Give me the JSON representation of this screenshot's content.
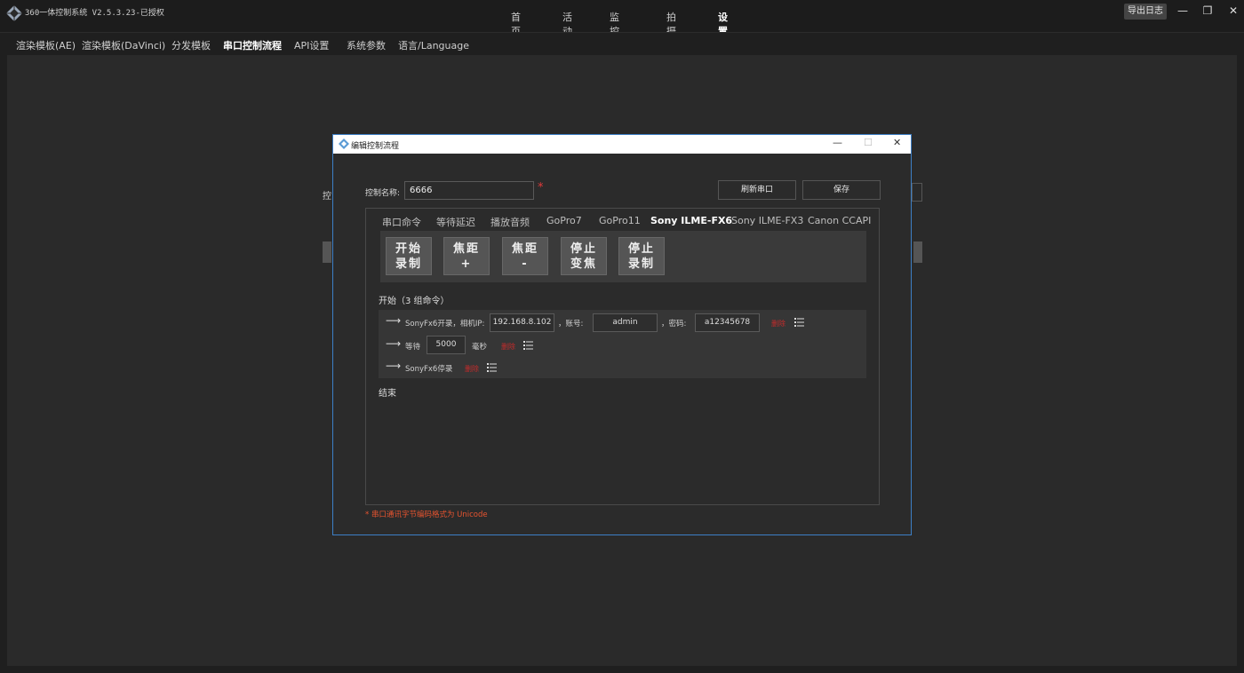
{
  "app": {
    "title": "360一体控制系统 V2.5.3.23-已授权",
    "export_log": "导出日志",
    "nav": [
      "首页",
      "活动",
      "监控台",
      "拍摄",
      "设置"
    ],
    "active_nav": "设置"
  },
  "subnav": [
    "渲染模板(AE)",
    "渲染模板(DaVinci)",
    "分发模板",
    "串口控制流程",
    "API设置",
    "系统参数",
    "语言/Language"
  ],
  "subnav_active": "串口控制流程",
  "background": {
    "partial_label": "控"
  },
  "dialog": {
    "title": "编辑控制流程",
    "name_label": "控制名称:",
    "name_value": "6666",
    "required_mark": "*",
    "refresh_button": "刷新串口",
    "save_button": "保存",
    "tabs": [
      "串口命令",
      "等待延迟",
      "播放音频",
      "GoPro7",
      "GoPro11",
      "Sony ILME-FX6",
      "Sony ILME-FX3",
      "Canon CCAPI"
    ],
    "active_tab": "Sony ILME-FX6",
    "commands": [
      {
        "line1": "开始",
        "line2": "录制"
      },
      {
        "line1": "焦距",
        "line2": "+"
      },
      {
        "line1": "焦距",
        "line2": "-"
      },
      {
        "line1": "停止",
        "line2": "变焦"
      },
      {
        "line1": "停止",
        "line2": "录制"
      }
    ],
    "start_label": "开始（3 组命令）",
    "steps": {
      "step1": {
        "arrow": "⟶",
        "text": "SonyFx6开录，相机IP:",
        "ip": "192.168.8.102",
        "account_label": "，账号:",
        "account": "admin",
        "password_label": "，密码:",
        "password": "a12345678",
        "delete": "删除"
      },
      "step2": {
        "arrow": "⟶",
        "text": "等待",
        "value": "5000",
        "unit": "毫秒",
        "delete": "删除"
      },
      "step3": {
        "arrow": "⟶",
        "text": "SonyFx6停录",
        "delete": "删除"
      }
    },
    "end_label": "结束",
    "footnote": "* 串口通讯字节编码格式为 Unicode"
  },
  "icons": {
    "app": "app-logo-icon",
    "dialog": "dialog-logo-icon",
    "list": "list-icon"
  }
}
